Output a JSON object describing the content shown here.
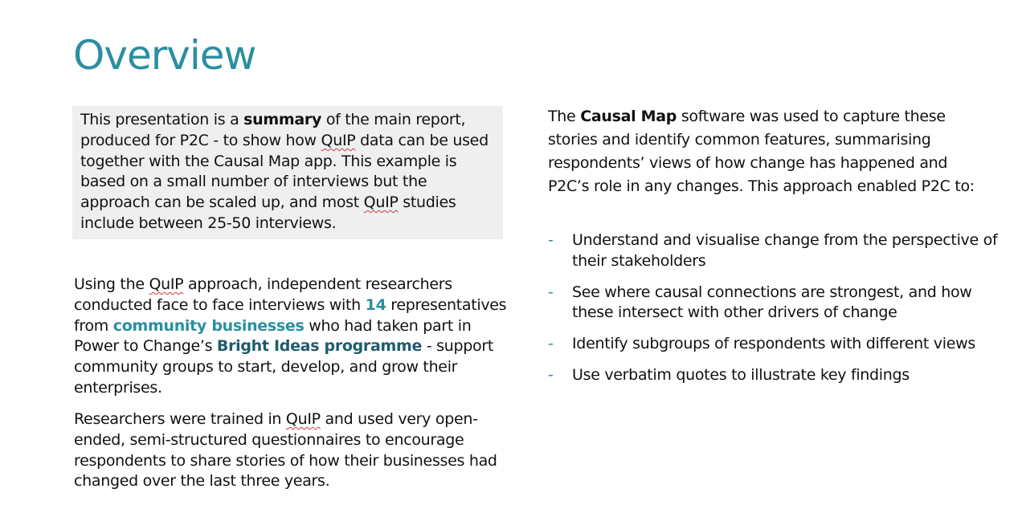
{
  "title": "Overview",
  "summary": {
    "t1": "This presentation is a ",
    "bold1": "summary",
    "t2": " of the main report, produced for P2C - to show how ",
    "quip1": "QuIP",
    "t3": " data can be used together with the Causal Map app. This example is based on a small number of interviews but the approach can be scaled up, and most ",
    "quip2": "QuIP",
    "t4": " studies include between 25-50 interviews."
  },
  "para1": {
    "t1": "Using the ",
    "quip": "QuIP",
    "t2": " approach, independent researchers conducted face to face interviews with ",
    "count": "14",
    "t3": " representatives from ",
    "cb": "community businesses",
    "t4": " who had taken part in Power to Change’s ",
    "bright": "Bright Ideas programme",
    "t5": " - support community groups to start, develop, and grow their enterprises."
  },
  "para2": {
    "t1": "Researchers were trained in ",
    "quip": "QuIP",
    "t2": " and used very open-ended, semi-structured questionnaires to encourage respondents to share stories of how their businesses had changed over the last three years."
  },
  "right": {
    "t1": "The ",
    "bold": "Causal Map",
    "t2": " software was used to capture these stories and identify common features, summarising respondents’ views of how change has happened and P2C’s role in any changes. This approach enabled P2C to:"
  },
  "bullet_marker": "-",
  "bullets": [
    "Understand and visualise change from the perspective of their stakeholders",
    "See where causal connections are strongest, and how these intersect with other drivers of change",
    "Identify subgroups of respondents with different views",
    "Use verbatim quotes to illustrate key findings"
  ],
  "colors": {
    "accent": "#2a8fa0",
    "dark_accent": "#1f5b6e",
    "box_bg": "#efefef"
  }
}
